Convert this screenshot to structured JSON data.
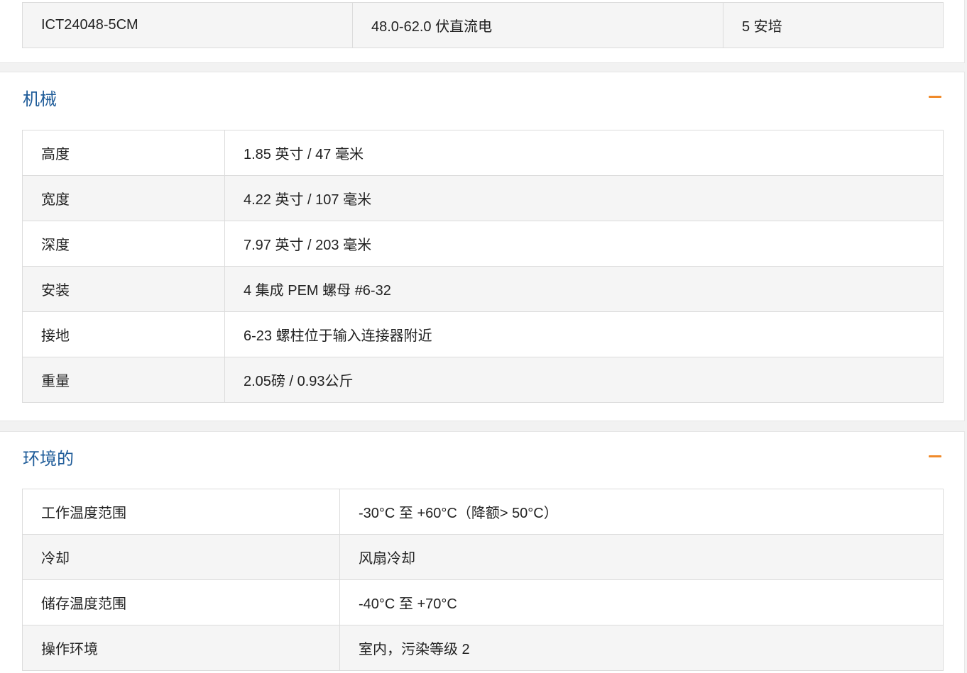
{
  "electrical_partial": {
    "rows": [
      {
        "model": "ICT24048-5CM",
        "voltage": "48.0-62.0 伏直流电",
        "current": "5 安培"
      }
    ]
  },
  "mechanical": {
    "title": "机械",
    "rows": [
      {
        "label": "高度",
        "value": "1.85 英寸 / 47 毫米"
      },
      {
        "label": "宽度",
        "value": "4.22 英寸 / 107 毫米"
      },
      {
        "label": "深度",
        "value": "7.97 英寸 / 203 毫米"
      },
      {
        "label": "安装",
        "value": "4 集成 PEM 螺母 #6-32"
      },
      {
        "label": "接地",
        "value": "6-23 螺柱位于输入连接器附近"
      },
      {
        "label": "重量",
        "value": "2.05磅 / 0.93公斤"
      }
    ]
  },
  "environmental": {
    "title": "环境的",
    "rows": [
      {
        "label": "工作温度范围",
        "value": "-30°C 至 +60°C（降额> 50°C）"
      },
      {
        "label": "冷却",
        "value": "风扇冷却"
      },
      {
        "label": "储存温度范围",
        "value": "-40°C 至 +70°C"
      },
      {
        "label": "操作环境",
        "value": "室内，污染等级 2"
      }
    ]
  },
  "colors": {
    "title_blue": "#1f5c99",
    "accent_orange": "#f08a2a",
    "row_alt": "#f5f5f5",
    "border": "#dcdcdc"
  },
  "icons": {
    "collapse": "minus-icon"
  }
}
